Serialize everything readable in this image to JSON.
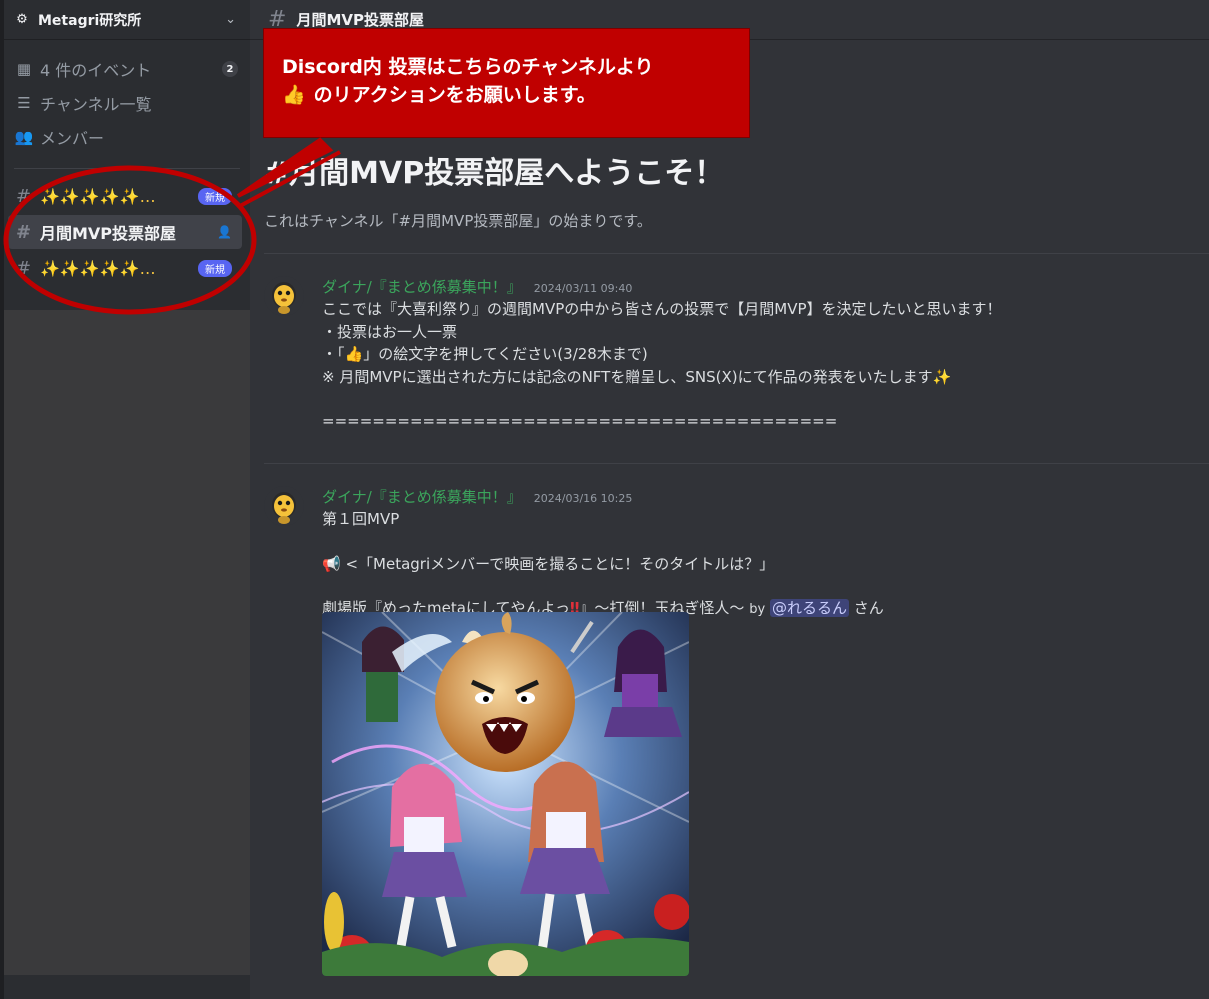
{
  "sidebar": {
    "server_name": "Metagri研究所",
    "nav": [
      {
        "label": "4 件のイベント",
        "badge": "2",
        "icon": "calendar-icon"
      },
      {
        "label": "チャンネル一覧",
        "icon": "channel-list-icon"
      },
      {
        "label": "メンバー",
        "icon": "members-icon"
      }
    ],
    "channels": [
      {
        "sparkles": "✨✨✨✨✨…",
        "badge": "新規"
      },
      {
        "label": "月間MVP投票部屋"
      },
      {
        "sparkles": "✨✨✨✨✨…",
        "badge": "新規"
      }
    ]
  },
  "channel": {
    "name": "月間MVP投票部屋",
    "welcome_title": "#月間MVP投票部屋へようこそ！",
    "welcome_sub": "これはチャンネル「#月間MVP投票部屋」の始まりです。"
  },
  "callout": {
    "line1": "Discord内 投票はこちらのチャンネルより",
    "thumb": "👍",
    "line2": "のリアクションをお願いします。"
  },
  "messages": [
    {
      "author": "ダイナ/『まとめ係募集中！』",
      "timestamp": "2024/03/11 09:40",
      "line1": "ここでは『大喜利祭り』の週間MVPの中から皆さんの投票で【月間MVP】を決定したいと思います！",
      "line2": "・投票はお一人一票",
      "line3_pre": "・「",
      "line3_thumb": "👍",
      "line3_post": "」の絵文字を押してください(3/28木まで)",
      "line4": "※ 月間MVPに選出された方には記念のNFTを贈呈し、SNS(X)にて作品の発表をいたします",
      "line4_spark": "✨",
      "line5": "========================================="
    },
    {
      "author": "ダイナ/『まとめ係募集中！』",
      "timestamp": "2024/03/16 10:25",
      "line1": "第１回MVP",
      "line2_icon": "📢",
      "line2": "<「Metagriメンバーで映画を撮ることに！そのタイトルは？」",
      "line3_pre": "劇場版『めったmetaにしてやんよっ",
      "line3_bang": "‼",
      "line3_post": "』〜打倒！玉ねぎ怪人〜",
      "line3_by": "by",
      "mention": "@れるるん",
      "line3_end": "さん"
    }
  ],
  "colors": {
    "callout_bg": "#c00000",
    "annotation": "#c00000",
    "author": "#3ba55c",
    "mention": "#5865f2"
  }
}
